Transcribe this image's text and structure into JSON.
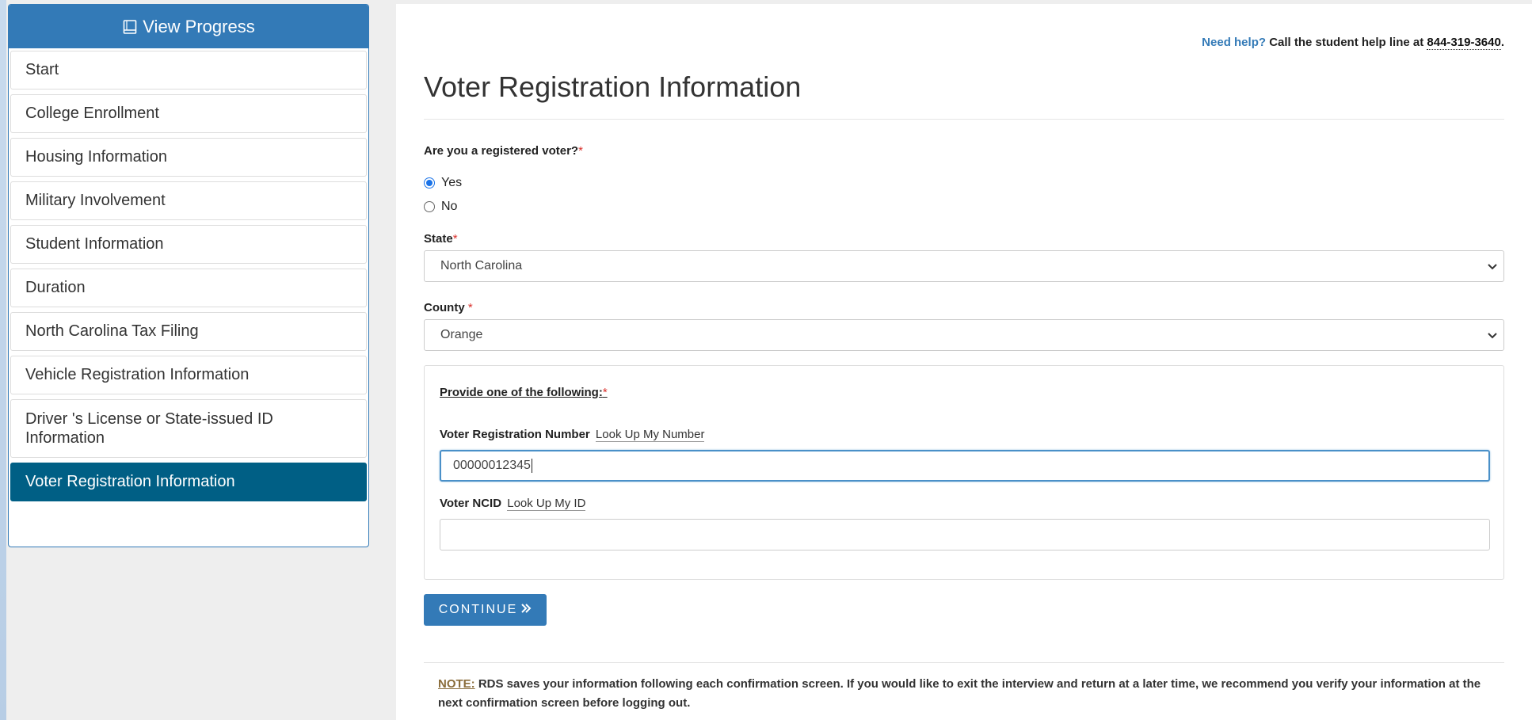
{
  "sidebar": {
    "header": "View Progress",
    "items": [
      {
        "label": "Start"
      },
      {
        "label": "College Enrollment"
      },
      {
        "label": "Housing Information"
      },
      {
        "label": "Military Involvement"
      },
      {
        "label": "Student Information"
      },
      {
        "label": "Duration"
      },
      {
        "label": "North Carolina Tax Filing"
      },
      {
        "label": "Vehicle Registration Information"
      },
      {
        "label": "Driver 's License or State-issued ID Information"
      },
      {
        "label": "Voter Registration Information",
        "active": true
      }
    ]
  },
  "help": {
    "need": "Need help?",
    "text": "Call the student help line at",
    "phone": "844-319-3640",
    "period": "."
  },
  "page": {
    "title": "Voter Registration Information"
  },
  "form": {
    "registered_question": "Are you a registered voter?",
    "required_mark": "*",
    "options": {
      "yes": "Yes",
      "no": "No"
    },
    "selected_option": "Yes",
    "state_label": "State",
    "state_value": "North Carolina",
    "county_label": "County",
    "county_value": "Orange",
    "provide_heading": "Provide one of the following:",
    "voter_reg_label": "Voter Registration Number",
    "voter_reg_lookup": "Look Up My Number",
    "voter_reg_value": "00000012345",
    "ncid_label": "Voter NCID",
    "ncid_lookup": "Look Up My ID",
    "ncid_value": "",
    "continue_label": "CONTINUE"
  },
  "note": {
    "label": "NOTE:",
    "text": "RDS saves your information following each confirmation screen. If you would like to exit the interview and return at a later time, we recommend you verify your information at the next confirmation screen before logging out."
  },
  "colors": {
    "primary": "#337ab7",
    "active_item": "#005f85",
    "required": "#d9302b"
  },
  "icons": {
    "sidebar_header": "book-icon",
    "continue": "double-chevron-right-icon",
    "select_arrow": "chevron-down-icon"
  }
}
